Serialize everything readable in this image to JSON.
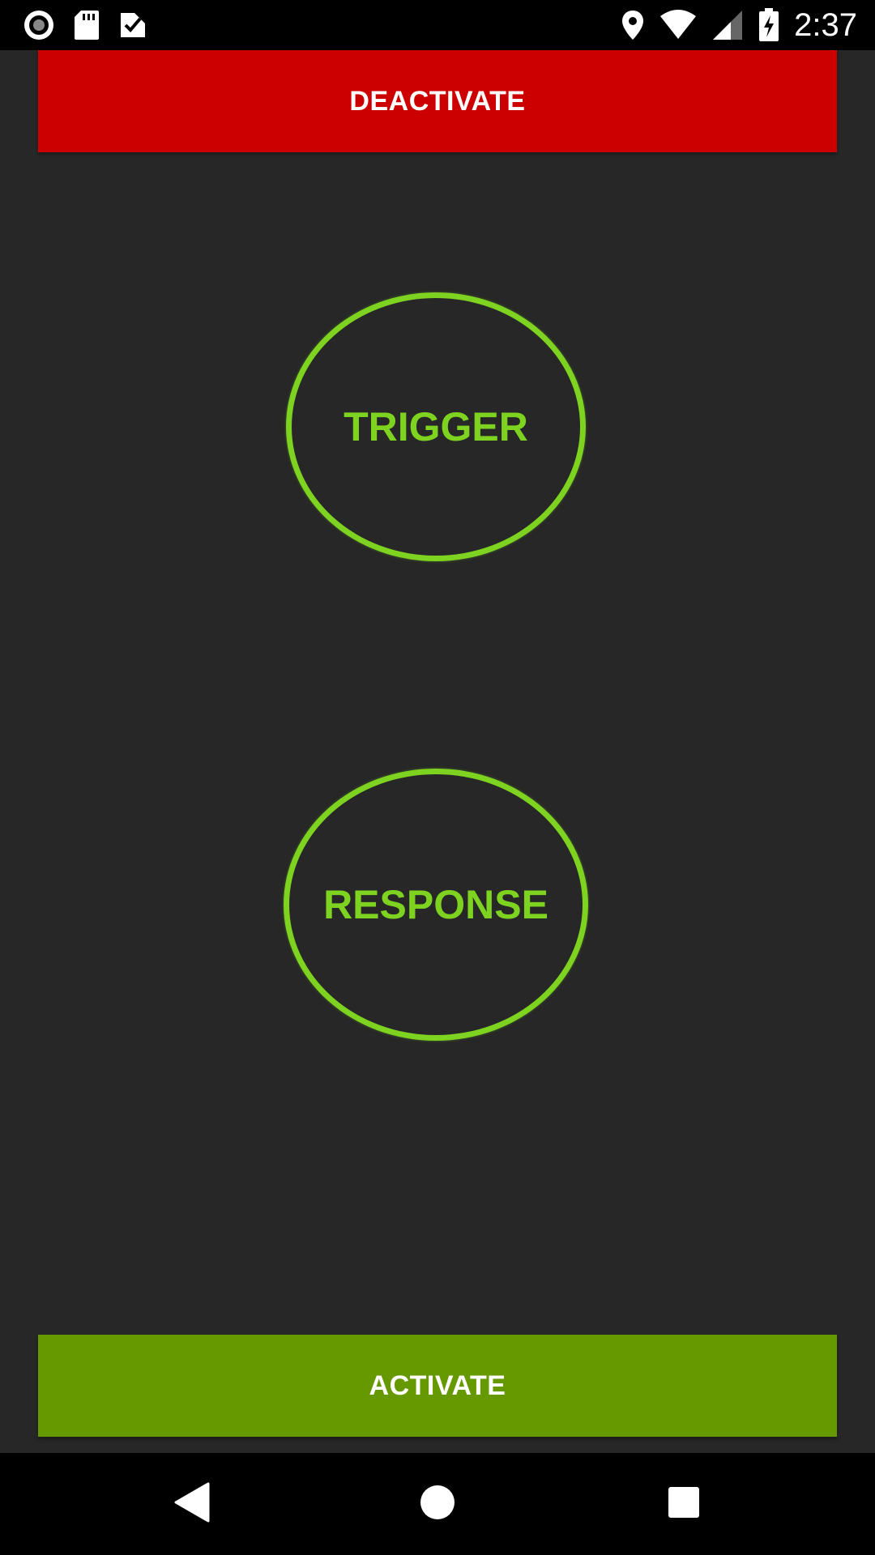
{
  "status_bar": {
    "time": "2:37",
    "left_icons": [
      "record-icon",
      "sd-card-icon",
      "task-check-icon"
    ],
    "right_icons": [
      "location-icon",
      "wifi-icon",
      "signal-icon",
      "battery-charging-icon"
    ]
  },
  "main": {
    "deactivate_label": "DEACTIVATE",
    "trigger_label": "TRIGGER",
    "response_label": "RESPONSE",
    "activate_label": "ACTIVATE"
  },
  "colors": {
    "background": "#272727",
    "deactivate": "#cc0000",
    "activate": "#669900",
    "accent_green": "#7ed321"
  },
  "nav_bar": {
    "icons": [
      "back-icon",
      "home-icon",
      "recents-icon"
    ]
  }
}
